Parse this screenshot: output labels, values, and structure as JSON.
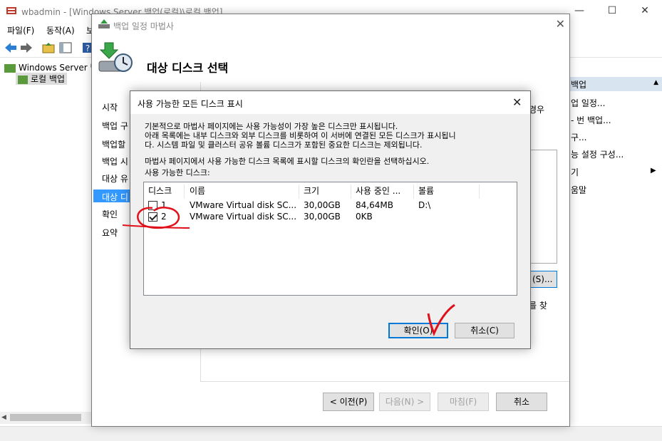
{
  "main_window": {
    "title": "wbadmin - [Windows Server 백업(로컬)\\로컬 백업]",
    "menu": [
      "파일(F)",
      "동작(A)",
      "보"
    ],
    "tree": {
      "root": "Windows Server 백",
      "child": "로컬 백업"
    },
    "right_panel": {
      "header": "백업",
      "items": [
        "업 일정...",
        "- 번 백업...",
        "구...",
        "능 설정 구성...",
        "기",
        "움말"
      ]
    }
  },
  "wizard": {
    "title": "백업 일정 마법사",
    "header_title": "대상 디스크 선택",
    "steps": [
      "시작",
      "백업 구",
      "백업할",
      "백업 시",
      "대상 유",
      "대상 디",
      "확인",
      "요약"
    ],
    "active_step_index": 5,
    "right_fragment_1": "경우",
    "show_all_button_fragment": "(S)...",
    "right_fragment_2": "를 찾",
    "buttons": {
      "prev": "< 이전(P)",
      "next": "다음(N) >",
      "finish": "마침(F)",
      "cancel": "취소"
    }
  },
  "modal": {
    "title": "사용 가능한 모든 디스크 표시",
    "description_lines": [
      "기본적으로 마법사 페이지에는 사용 가능성이 가장 높은 디스크만 표시됩니다.",
      "아래 목록에는 내부 디스크와 외부 디스크를 비롯하여 이 서버에 연결된 모든 디스크가 표시됩니",
      "다. 시스템 파일 및 클러스터 공유 볼륨 디스크가 포함된 중요한 디스크는 제외됩니다."
    ],
    "instruction": "마법사 페이지에서 사용 가능한 디스크 목록에 표시할 디스크의 확인란을 선택하십시오.",
    "list_label": "사용 가능한 디스크:",
    "columns": [
      "디스크",
      "이름",
      "크기",
      "사용 중인 ...",
      "볼륨"
    ],
    "rows": [
      {
        "disk": "1",
        "checked": false,
        "name": "VMware Virtual disk SC...",
        "size": "30,00GB",
        "used": "84,64MB",
        "volume": "D:\\"
      },
      {
        "disk": "2",
        "checked": true,
        "name": "VMware Virtual disk SC...",
        "size": "30,00GB",
        "used": "0KB",
        "volume": ""
      }
    ],
    "ok_label": "확인(O)",
    "cancel_label": "취소(C)"
  },
  "colors": {
    "selection": "#3399ff",
    "default_button_border": "#0078d7",
    "annotation": "#e0101a"
  }
}
